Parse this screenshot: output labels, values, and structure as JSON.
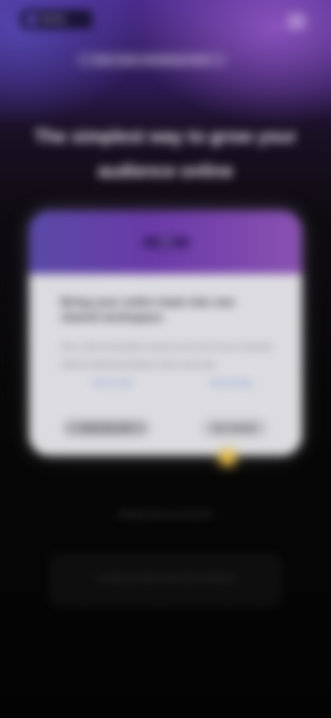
{
  "brand": {
    "name": "NOVA"
  },
  "announcement": "New: Faster scheduling is here",
  "hero": {
    "headline": "The simplest way to grow your audience online"
  },
  "card": {
    "header_label": "Beta",
    "title": "Bring your entire team into one shared workspace",
    "text": "Plan, draft and publish content across all of your channels without switching between tools every day.",
    "link_primary": "Learn more",
    "link_secondary": "See pricing",
    "secondary_button": "Start free trial",
    "primary_button": "Get started"
  },
  "footer": {
    "link": "Already have an account?",
    "note": "Trusted by creators and teams worldwide"
  },
  "colors": {
    "accent_purple": "#6a3aa8",
    "accent_blue": "#5a4aa6",
    "highlight_gold": "#e0b844"
  }
}
